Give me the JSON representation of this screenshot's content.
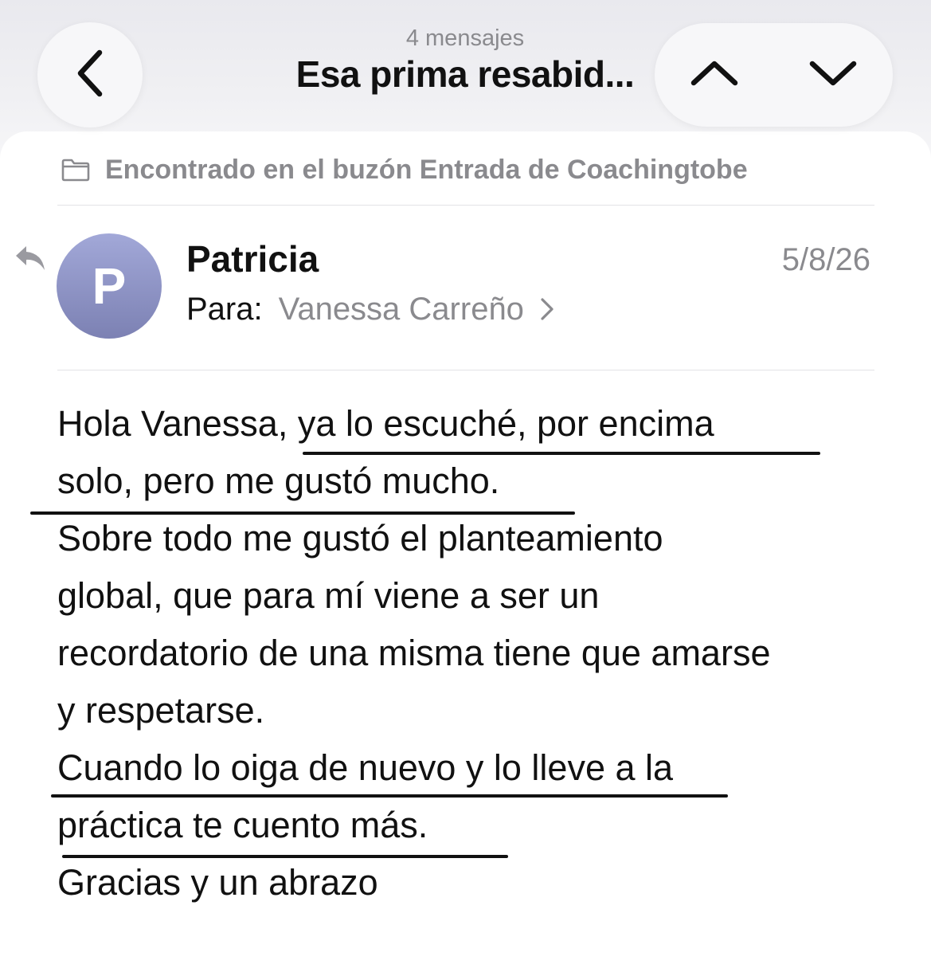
{
  "header": {
    "message_count": "4 mensajes",
    "subject": "Esa prima resabid...",
    "back_icon": "chevron-left-icon",
    "prev_icon": "chevron-up-icon",
    "next_icon": "chevron-down-icon"
  },
  "mailbox_info": {
    "icon": "folder-icon",
    "text": "Encontrado en el buzón Entrada de Coachingtobe"
  },
  "message": {
    "reply_icon": "reply-icon",
    "avatar_letter": "P",
    "sender": "Patricia",
    "date": "5/8/26",
    "to_label": "Para:",
    "to_name": "Vanessa Carreño",
    "body_lines": [
      "Hola Vanessa, ya lo escuché, por encima",
      "solo, pero me gustó mucho.",
      "Sobre todo me gustó el planteamiento",
      "global, que para mí viene a ser un",
      "recordatorio de una misma tiene que amarse",
      "y respetarse.",
      "Cuando lo oiga de nuevo y lo lleve a la",
      "práctica te cuento más.",
      "Gracias y un abrazo"
    ]
  },
  "colors": {
    "secondary_text": "#8a8a8e",
    "avatar_top": "#a2a8d8",
    "avatar_bottom": "#7c81b3",
    "underline": "#111111"
  }
}
